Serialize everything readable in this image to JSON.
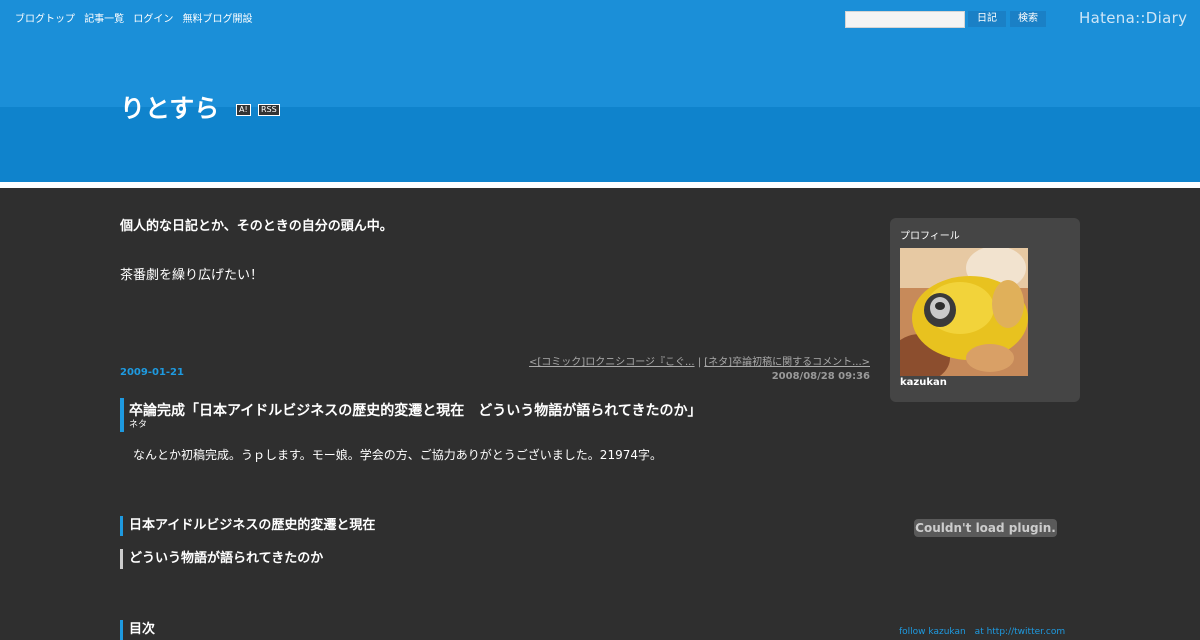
{
  "nav": [
    "ブログトップ",
    "記事一覧",
    "ログイン",
    "無料ブログ開設"
  ],
  "search": {
    "diary_label": "日記",
    "search_label": "検索"
  },
  "logo": "Hatena::Diary",
  "site": {
    "title": "りとすら",
    "badge_a": "A!",
    "badge_rss": "RSS"
  },
  "description": {
    "line1": "個人的な日記とか、そのときの自分の頭ん中。",
    "line2": "茶番劇を繰り広げたい！"
  },
  "pager": {
    "prev": "<[コミック]ロクニシコージ『こぐ...",
    "sep": " | ",
    "next": "[ネタ]卒論初稿に関するコメント...>"
  },
  "entry": {
    "date": "2009-01-21",
    "time": "2008/08/28 09:36",
    "title": "卒論完成「日本アイドルビジネスの歴史的変遷と現在　どういう物語が語られてきたのか」",
    "category": "ネタ",
    "body": "なんとか初稿完成。うｐします。モー娘。学会の方、ご協力ありがとうございました。21974字。",
    "heading1": "日本アイドルビジネスの歴史的変遷と現在",
    "heading2": "どういう物語が語られてきたのか",
    "heading3": "目次"
  },
  "profile": {
    "heading": "プロフィール",
    "name": "kazukan"
  },
  "plugin_message": "Couldn't load plugin.",
  "twitter": "follow kazukan　at http://twitter.com",
  "colors": {
    "header_blue": "#1b8fd8",
    "accent": "#1e9ae0",
    "background": "#2f2f2f"
  }
}
